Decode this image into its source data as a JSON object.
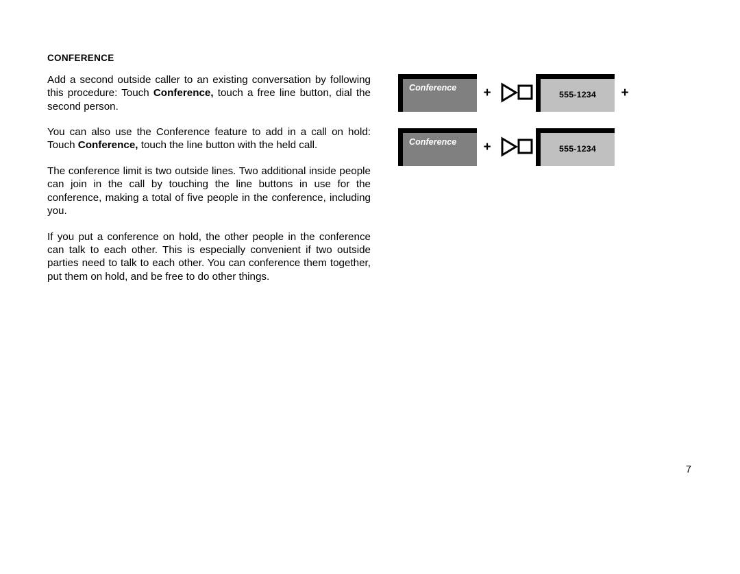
{
  "document": {
    "section_heading": "CONFERENCE",
    "page_number": "7",
    "paragraphs": [
      {
        "id": "p1",
        "segments": [
          {
            "text": "Add a second outside caller to an existing conversation by following this procedure: Touch ",
            "bold": false
          },
          {
            "text": "Conference,",
            "bold": true
          },
          {
            "text": " touch a free line button, dial the second person.",
            "bold": false
          }
        ]
      },
      {
        "id": "p2",
        "segments": [
          {
            "text": "You can also use the Conference feature to add in a call on hold: Touch ",
            "bold": false
          },
          {
            "text": "Conference,",
            "bold": true
          },
          {
            "text": " touch the line button with the held call.",
            "bold": false
          }
        ]
      },
      {
        "id": "p3",
        "segments": [
          {
            "text": "The conference limit is two outside lines. Two additional inside people can join in the call by touching the line buttons in use for the conference, making a total of five people in the conference, including you.",
            "bold": false
          }
        ]
      },
      {
        "id": "p4",
        "segments": [
          {
            "text": "If you put a conference on hold, the other people in the conference can talk to each other. This is especially convenient if two outside parties need to talk to each other. You can conference them together, put them on hold, and be free to do other things.",
            "bold": false
          }
        ]
      }
    ]
  },
  "diagram": {
    "icon_name": "touch-triangle-square-icon",
    "rows": [
      {
        "conference_button_label": "Conference",
        "plus_1": "+",
        "number_box_label": "555-1234",
        "trailing_plus": "+",
        "has_trailing_plus": true
      },
      {
        "conference_button_label": "Conference",
        "plus_1": "+",
        "number_box_label": "555-1234",
        "trailing_plus": "",
        "has_trailing_plus": false
      }
    ]
  },
  "colors": {
    "page_background": "#ffffff",
    "text": "#000000",
    "conference_button_fill": "#808080",
    "conference_button_text": "#ffffff",
    "number_box_fill": "#c0c0c0",
    "box_border": "#000000"
  }
}
